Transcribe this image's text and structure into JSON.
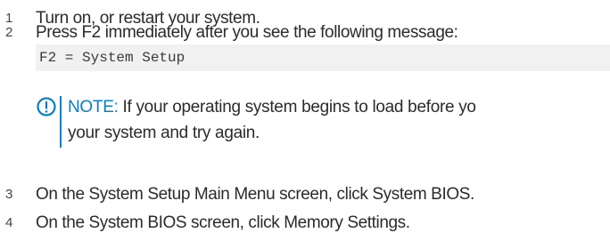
{
  "steps": [
    {
      "number": "1",
      "text": "Turn on, or restart your system."
    },
    {
      "number": "2",
      "text": "Press F2 immediately after you see the following message:"
    },
    {
      "number": "3",
      "text": "On the System Setup Main Menu screen, click System BIOS."
    },
    {
      "number": "4",
      "text": "On the System BIOS screen, click Memory Settings."
    }
  ],
  "code_block": {
    "text": "F2 = System Setup"
  },
  "note": {
    "icon": "info-icon",
    "label": "NOTE:",
    "text_line1": "If your operating system begins to load before yo",
    "text_line2": "your system and try again."
  },
  "colors": {
    "accent": "#0a7ec2",
    "code_background": "#f1f1f1",
    "text": "#2b2b2b"
  }
}
